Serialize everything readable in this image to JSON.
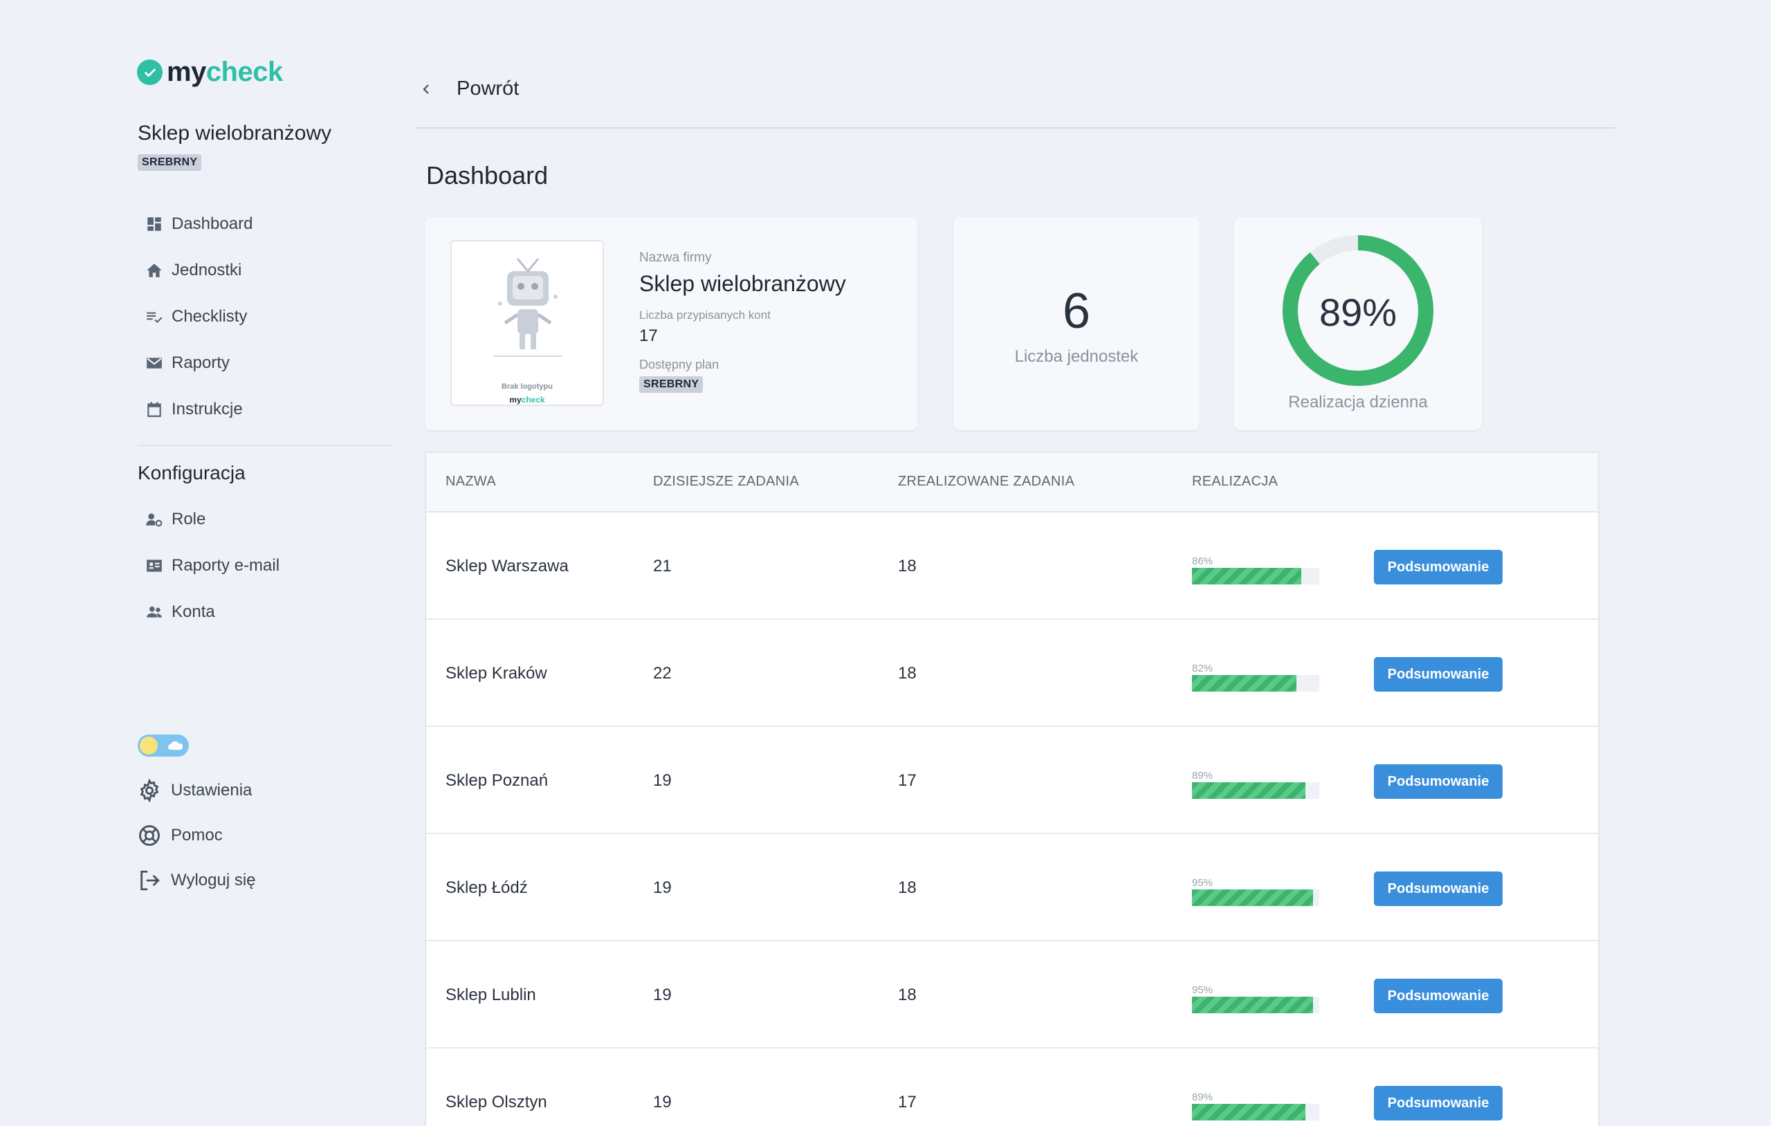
{
  "brand": {
    "part1": "my",
    "part2": "check",
    "accent": "#2ebfa5"
  },
  "company": {
    "name": "Sklep wielobranżowy",
    "plan_badge": "SREBRNY"
  },
  "sidebar": {
    "main_items": [
      {
        "label": "Dashboard",
        "icon": "dashboard-icon"
      },
      {
        "label": "Jednostki",
        "icon": "home-icon"
      },
      {
        "label": "Checklisty",
        "icon": "checklist-icon"
      },
      {
        "label": "Raporty",
        "icon": "mail-icon"
      },
      {
        "label": "Instrukcje",
        "icon": "calendar-icon"
      }
    ],
    "config_title": "Konfiguracja",
    "config_items": [
      {
        "label": "Role",
        "icon": "user-gear-icon"
      },
      {
        "label": "Raporty e-mail",
        "icon": "id-card-icon"
      },
      {
        "label": "Konta",
        "icon": "group-icon"
      }
    ],
    "bottom_items": [
      {
        "label": "Ustawienia",
        "icon": "gear-icon"
      },
      {
        "label": "Pomoc",
        "icon": "lifebuoy-icon"
      },
      {
        "label": "Wyloguj się",
        "icon": "logout-icon"
      }
    ]
  },
  "header": {
    "back_label": "Powrót",
    "title": "Dashboard"
  },
  "company_card": {
    "logo_placeholder": "Brak logotypu",
    "name_label": "Nazwa firmy",
    "name": "Sklep wielobranżowy",
    "accounts_label": "Liczba przypisanych kont",
    "accounts": "17",
    "plan_label": "Dostępny plan",
    "plan": "SREBRNY"
  },
  "units_card": {
    "value": "6",
    "label": "Liczba jednostek"
  },
  "rate_card": {
    "value": "89%",
    "fraction": 0.89,
    "label": "Realizacja dzienna",
    "color": "#3bb56b"
  },
  "table": {
    "headers": {
      "name": "NAZWA",
      "today": "DZISIEJSZE ZADANIA",
      "done": "ZREALIZOWANE ZADANIA",
      "rate": "REALIZACJA"
    },
    "button_label": "Podsumowanie",
    "rows": [
      {
        "name": "Sklep Warszawa",
        "today": "21",
        "done": "18",
        "rate": "86%",
        "fraction": 0.86
      },
      {
        "name": "Sklep Kraków",
        "today": "22",
        "done": "18",
        "rate": "82%",
        "fraction": 0.82
      },
      {
        "name": "Sklep Poznań",
        "today": "19",
        "done": "17",
        "rate": "89%",
        "fraction": 0.89
      },
      {
        "name": "Sklep Łódź",
        "today": "19",
        "done": "18",
        "rate": "95%",
        "fraction": 0.95
      },
      {
        "name": "Sklep Lublin",
        "today": "19",
        "done": "18",
        "rate": "95%",
        "fraction": 0.95
      },
      {
        "name": "Sklep Olsztyn",
        "today": "19",
        "done": "17",
        "rate": "89%",
        "fraction": 0.89
      }
    ]
  }
}
